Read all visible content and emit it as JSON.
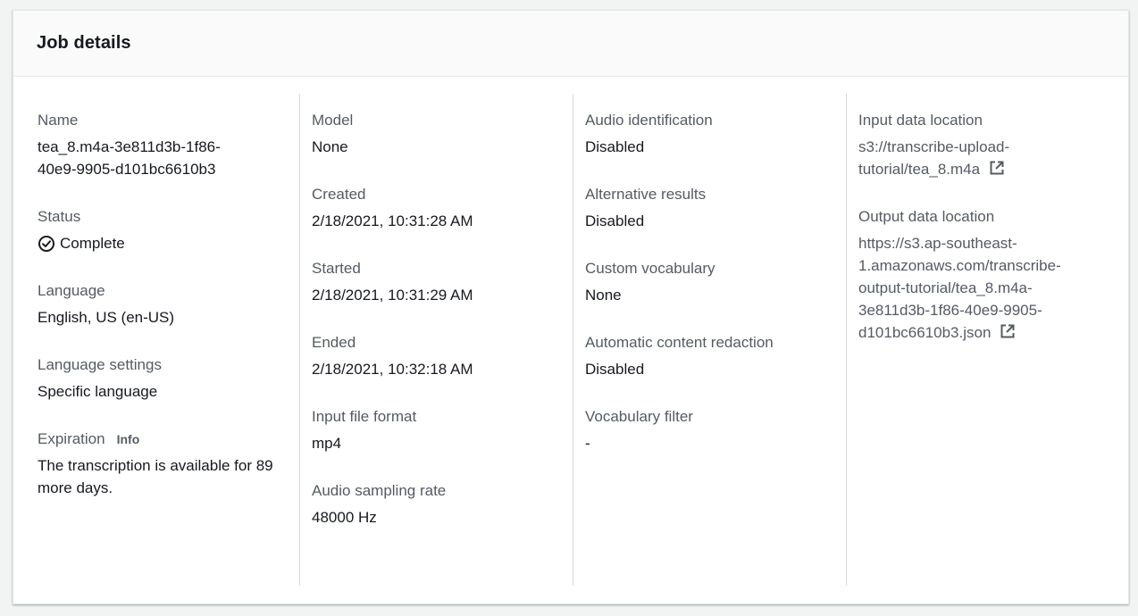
{
  "panel": {
    "title": "Job details"
  },
  "col1": {
    "name": {
      "label": "Name",
      "value": "tea_8.m4a-3e811d3b-1f86-40e9-9905-d101bc6610b3"
    },
    "status": {
      "label": "Status",
      "value": "Complete",
      "icon": "check-circle-icon"
    },
    "language": {
      "label": "Language",
      "value": "English, US (en-US)"
    },
    "language_settings": {
      "label": "Language settings",
      "value": "Specific language"
    },
    "expiration": {
      "label": "Expiration",
      "info": "Info",
      "value": "The transcription is available for 89 more days."
    }
  },
  "col2": {
    "model": {
      "label": "Model",
      "value": "None"
    },
    "created": {
      "label": "Created",
      "value": "2/18/2021, 10:31:28 AM"
    },
    "started": {
      "label": "Started",
      "value": "2/18/2021, 10:31:29 AM"
    },
    "ended": {
      "label": "Ended",
      "value": "2/18/2021, 10:32:18 AM"
    },
    "input_format": {
      "label": "Input file format",
      "value": "mp4"
    },
    "sampling_rate": {
      "label": "Audio sampling rate",
      "value": "48000 Hz"
    }
  },
  "col3": {
    "audio_identification": {
      "label": "Audio identification",
      "value": "Disabled"
    },
    "alternative_results": {
      "label": "Alternative results",
      "value": "Disabled"
    },
    "custom_vocabulary": {
      "label": "Custom vocabulary",
      "value": "None"
    },
    "content_redaction": {
      "label": "Automatic content redaction",
      "value": "Disabled"
    },
    "vocabulary_filter": {
      "label": "Vocabulary filter",
      "value": "-"
    }
  },
  "col4": {
    "input_location": {
      "label": "Input data location",
      "value": "s3://transcribe-upload-tutorial/tea_8.m4a",
      "icon": "external-link-icon"
    },
    "output_location": {
      "label": "Output data location",
      "value": "https://s3.ap-southeast-1.amazonaws.com/transcribe-output-tutorial/tea_8.m4a-3e811d3b-1f86-40e9-9905-d101bc6610b3.json",
      "icon": "external-link-icon"
    }
  },
  "colors": {
    "background": "#f2f3f3",
    "panel": "#ffffff",
    "header": "#fafafa",
    "label": "#545b64",
    "text": "#16191f",
    "divider": "#d5dbdb"
  }
}
